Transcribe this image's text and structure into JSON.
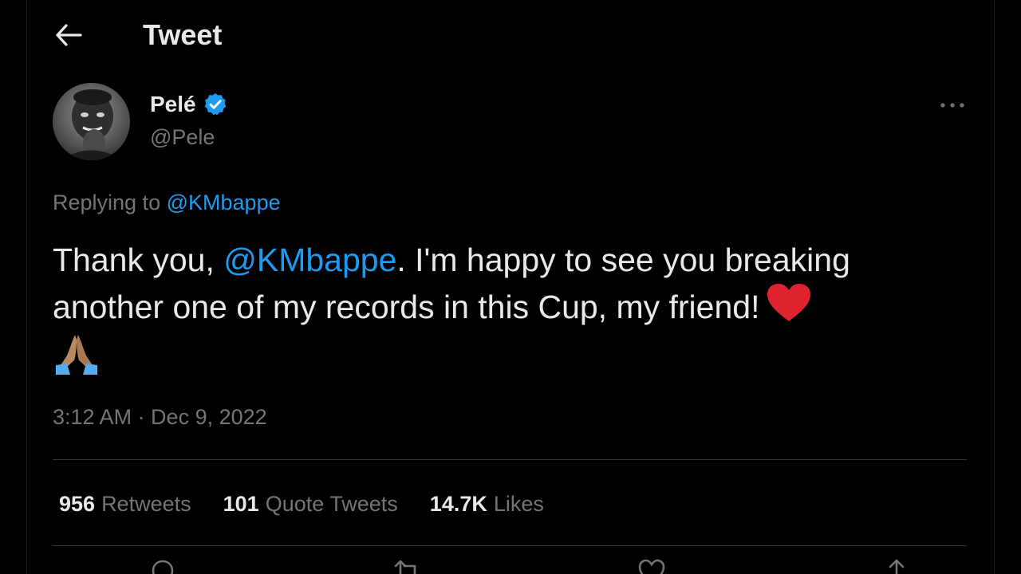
{
  "header": {
    "title": "Tweet",
    "back_icon": "arrow-left-icon"
  },
  "author": {
    "display_name": "Pelé",
    "handle": "@Pele",
    "verified_icon": "verified-badge-icon",
    "verified_color": "#1d9bf0",
    "more_icon": "more-horizontal-icon"
  },
  "reply": {
    "prefix": "Replying to",
    "to_handle": "@KMbappe"
  },
  "tweet": {
    "text_start": "Thank you, ",
    "mention": "@KMbappe",
    "text_end": ". I'm happy to see you breaking another one of my records in this Cup, my friend!",
    "emojis": [
      "red-heart-emoji",
      "folded-hands-emoji"
    ]
  },
  "timestamp": "3:12 AM · Dec 9, 2022",
  "stats": [
    {
      "count": "956",
      "label": "Retweets"
    },
    {
      "count": "101",
      "label": "Quote Tweets"
    },
    {
      "count": "14.7K",
      "label": "Likes"
    }
  ],
  "actions": [
    "reply-icon",
    "retweet-icon",
    "like-icon",
    "share-icon"
  ],
  "colors": {
    "background": "#000000",
    "text": "#e7e9ea",
    "secondary_text": "#71767b",
    "link": "#1d9bf0",
    "divider": "#2f3336"
  }
}
